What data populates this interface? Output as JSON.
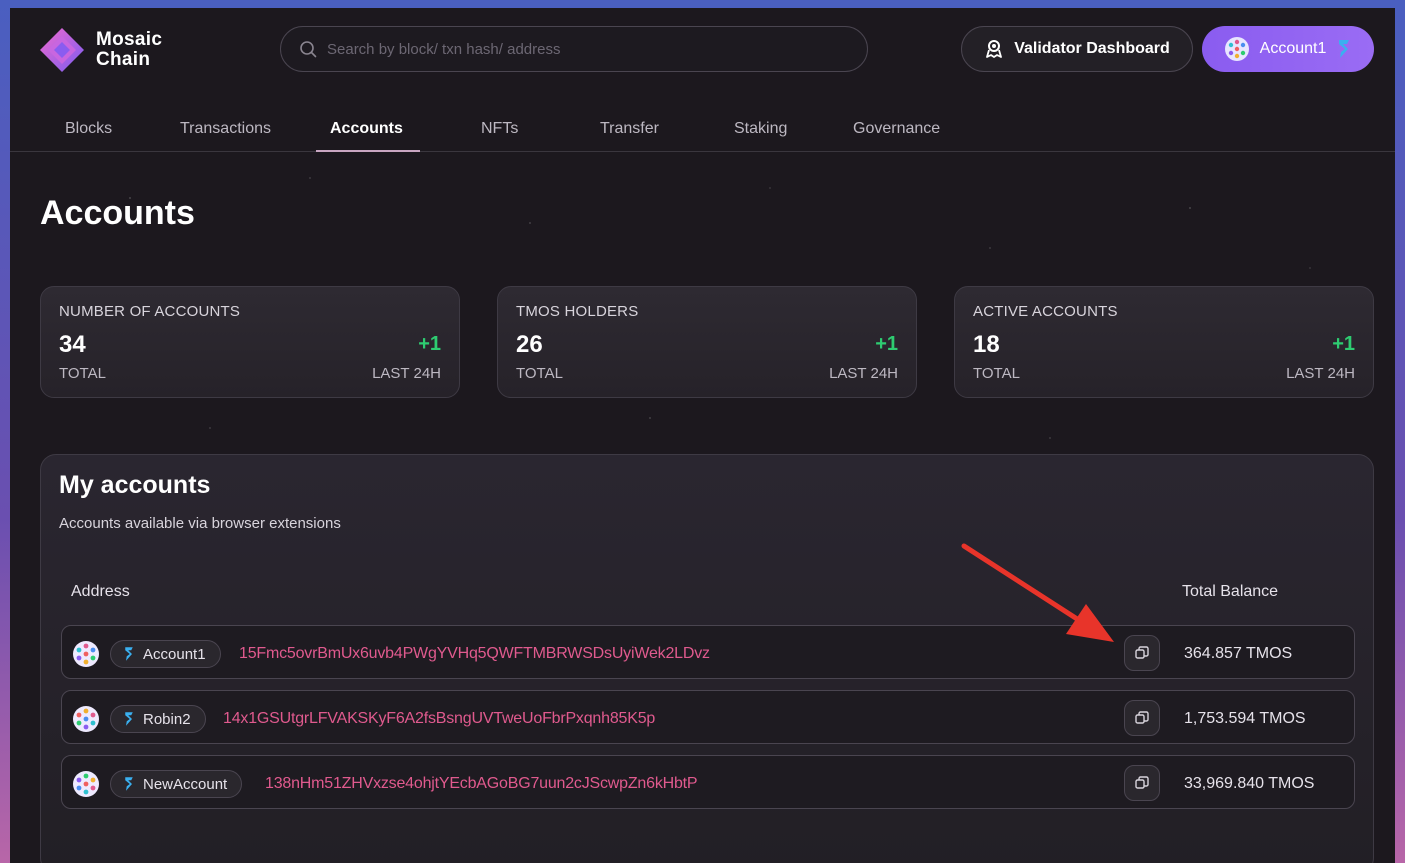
{
  "brand": {
    "line1": "Mosaic",
    "line2": "Chain"
  },
  "search": {
    "placeholder": "Search by block/ txn hash/ address"
  },
  "header": {
    "validator_label": "Validator Dashboard",
    "account_label": "Account1"
  },
  "tabs": [
    {
      "label": "Blocks"
    },
    {
      "label": "Transactions"
    },
    {
      "label": "Accounts"
    },
    {
      "label": "NFTs"
    },
    {
      "label": "Transfer"
    },
    {
      "label": "Staking"
    },
    {
      "label": "Governance"
    }
  ],
  "active_tab": "Accounts",
  "page_title": "Accounts",
  "stats": [
    {
      "label": "NUMBER OF ACCOUNTS",
      "value": "34",
      "delta": "+1",
      "sub_left": "TOTAL",
      "sub_right": "LAST 24H"
    },
    {
      "label": "TMOS HOLDERS",
      "value": "26",
      "delta": "+1",
      "sub_left": "TOTAL",
      "sub_right": "LAST 24H"
    },
    {
      "label": "ACTIVE ACCOUNTS",
      "value": "18",
      "delta": "+1",
      "sub_left": "TOTAL",
      "sub_right": "LAST 24H"
    }
  ],
  "my_accounts": {
    "title": "My accounts",
    "subtitle": "Accounts available via browser extensions",
    "col_address": "Address",
    "col_balance": "Total Balance",
    "rows": [
      {
        "name": "Account1",
        "address": "15Fmc5ovrBmUx6uvb4PWgYVHq5QWFTMBRWSDsUyiWek2LDvz",
        "balance": "364.857 TMOS"
      },
      {
        "name": "Robin2",
        "address": "14x1GSUtgrLFVAKSKyF6A2fsBsngUVTweUoFbrPxqnh85K5p",
        "balance": "1,753.594 TMOS"
      },
      {
        "name": "NewAccount",
        "address": "138nHm51ZHVxzse4ohjtYEcbAGoBG7uun2cJScwpZn6kHbtP",
        "balance": "33,969.840 TMOS"
      }
    ]
  },
  "colors": {
    "accent": "#8a5cf0",
    "positive": "#2ecc71",
    "address": "#e05a8e",
    "annotation_arrow": "#e8342a"
  },
  "icons": {
    "search": "search-icon",
    "validator": "validator-icon",
    "copy": "copy-icon",
    "polkadot": "polkadot-s-icon"
  }
}
